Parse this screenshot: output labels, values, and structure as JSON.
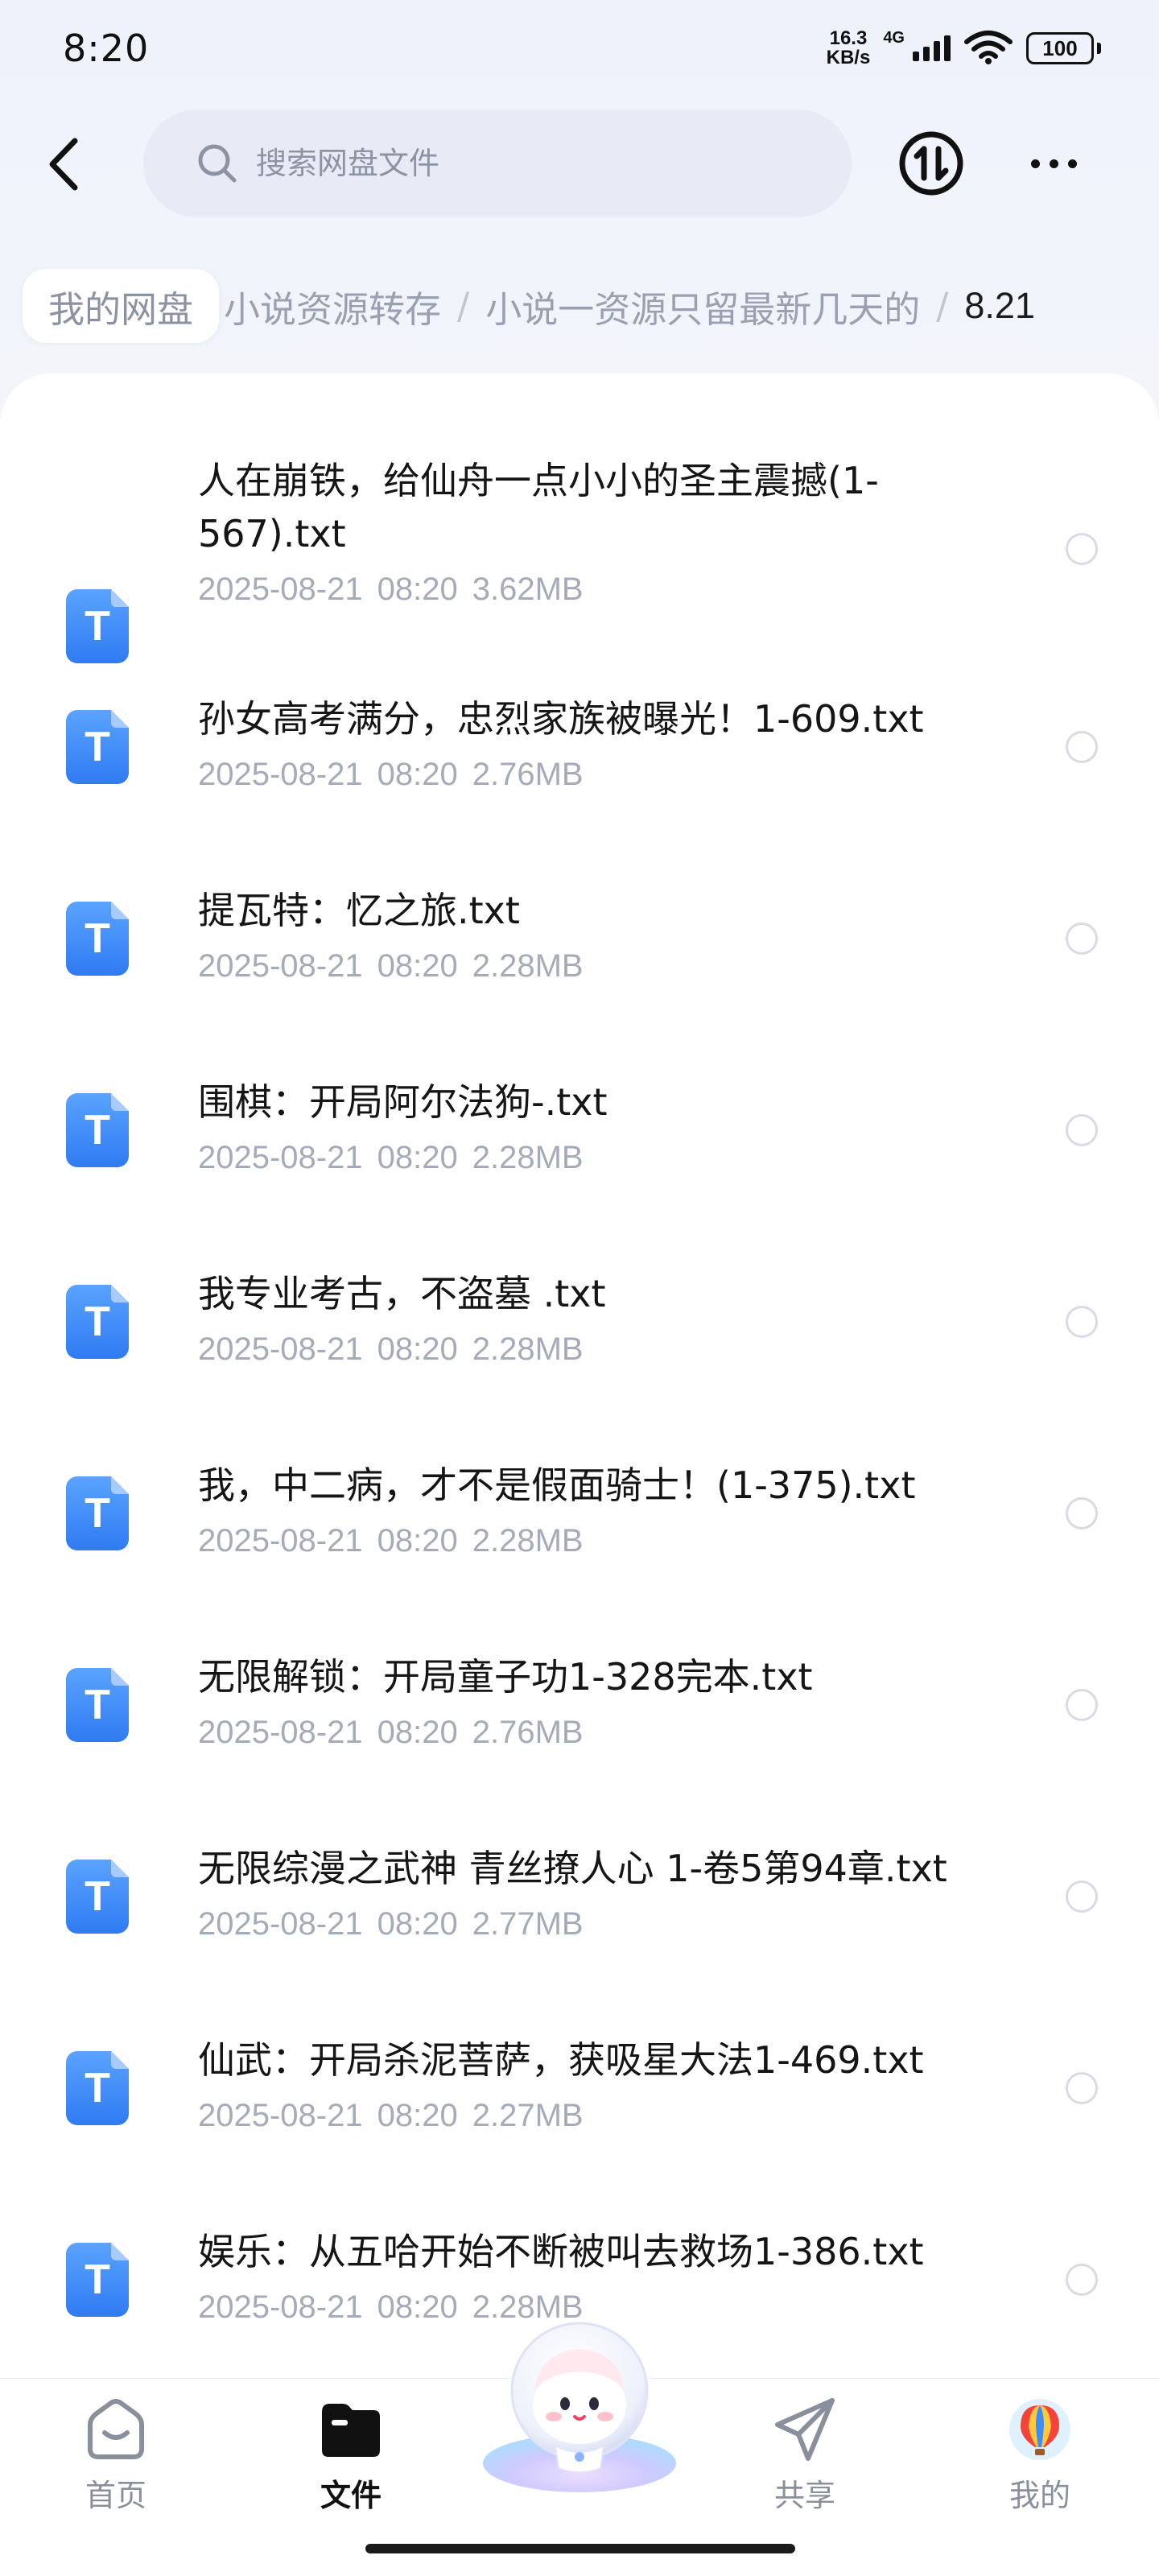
{
  "status_bar": {
    "time": "8:20",
    "net_speed_value": "16.3",
    "net_speed_unit": "KB/s",
    "network_type": "4G",
    "battery": "100"
  },
  "search": {
    "placeholder": "搜索网盘文件"
  },
  "breadcrumb": {
    "root": "我的网盘",
    "level1": "小说资源转存",
    "level2": "小说一资源只留最新几天的",
    "current": "8.21",
    "separator": "/"
  },
  "files": [
    {
      "name": "人在崩铁，给仙舟一点小小的圣主震撼(1-567).txt",
      "date": "2025-08-21",
      "time": "08:20",
      "size": "3.62MB"
    },
    {
      "name": "孙女高考满分，忠烈家族被曝光！1-609.txt",
      "date": "2025-08-21",
      "time": "08:20",
      "size": "2.76MB"
    },
    {
      "name": "提瓦特：忆之旅.txt",
      "date": "2025-08-21",
      "time": "08:20",
      "size": "2.28MB"
    },
    {
      "name": "围棋：开局阿尔法狗-.txt",
      "date": "2025-08-21",
      "time": "08:20",
      "size": "2.28MB"
    },
    {
      "name": "我专业考古，不盗墓 .txt",
      "date": "2025-08-21",
      "time": "08:20",
      "size": "2.28MB"
    },
    {
      "name": "我，中二病，才不是假面骑士！(1-375).txt",
      "date": "2025-08-21",
      "time": "08:20",
      "size": "2.28MB"
    },
    {
      "name": "无限解锁：开局童子功1-328完本.txt",
      "date": "2025-08-21",
      "time": "08:20",
      "size": "2.76MB"
    },
    {
      "name": "无限综漫之武神 青丝撩人心 1-卷5第94章.txt",
      "date": "2025-08-21",
      "time": "08:20",
      "size": "2.77MB"
    },
    {
      "name": "仙武：开局杀泥菩萨，获吸星大法1-469.txt",
      "date": "2025-08-21",
      "time": "08:20",
      "size": "2.27MB"
    },
    {
      "name": "娱乐：从五哈开始不断被叫去救场1-386.txt",
      "date": "2025-08-21",
      "time": "08:20",
      "size": "2.28MB"
    }
  ],
  "file_icon_letter": "T",
  "nav": {
    "home": "首页",
    "files": "文件",
    "share": "共享",
    "mine": "我的"
  },
  "colors": {
    "accent": "#2f7bf2",
    "meta_text": "#a6abb8",
    "background": "#f3f5fb"
  }
}
